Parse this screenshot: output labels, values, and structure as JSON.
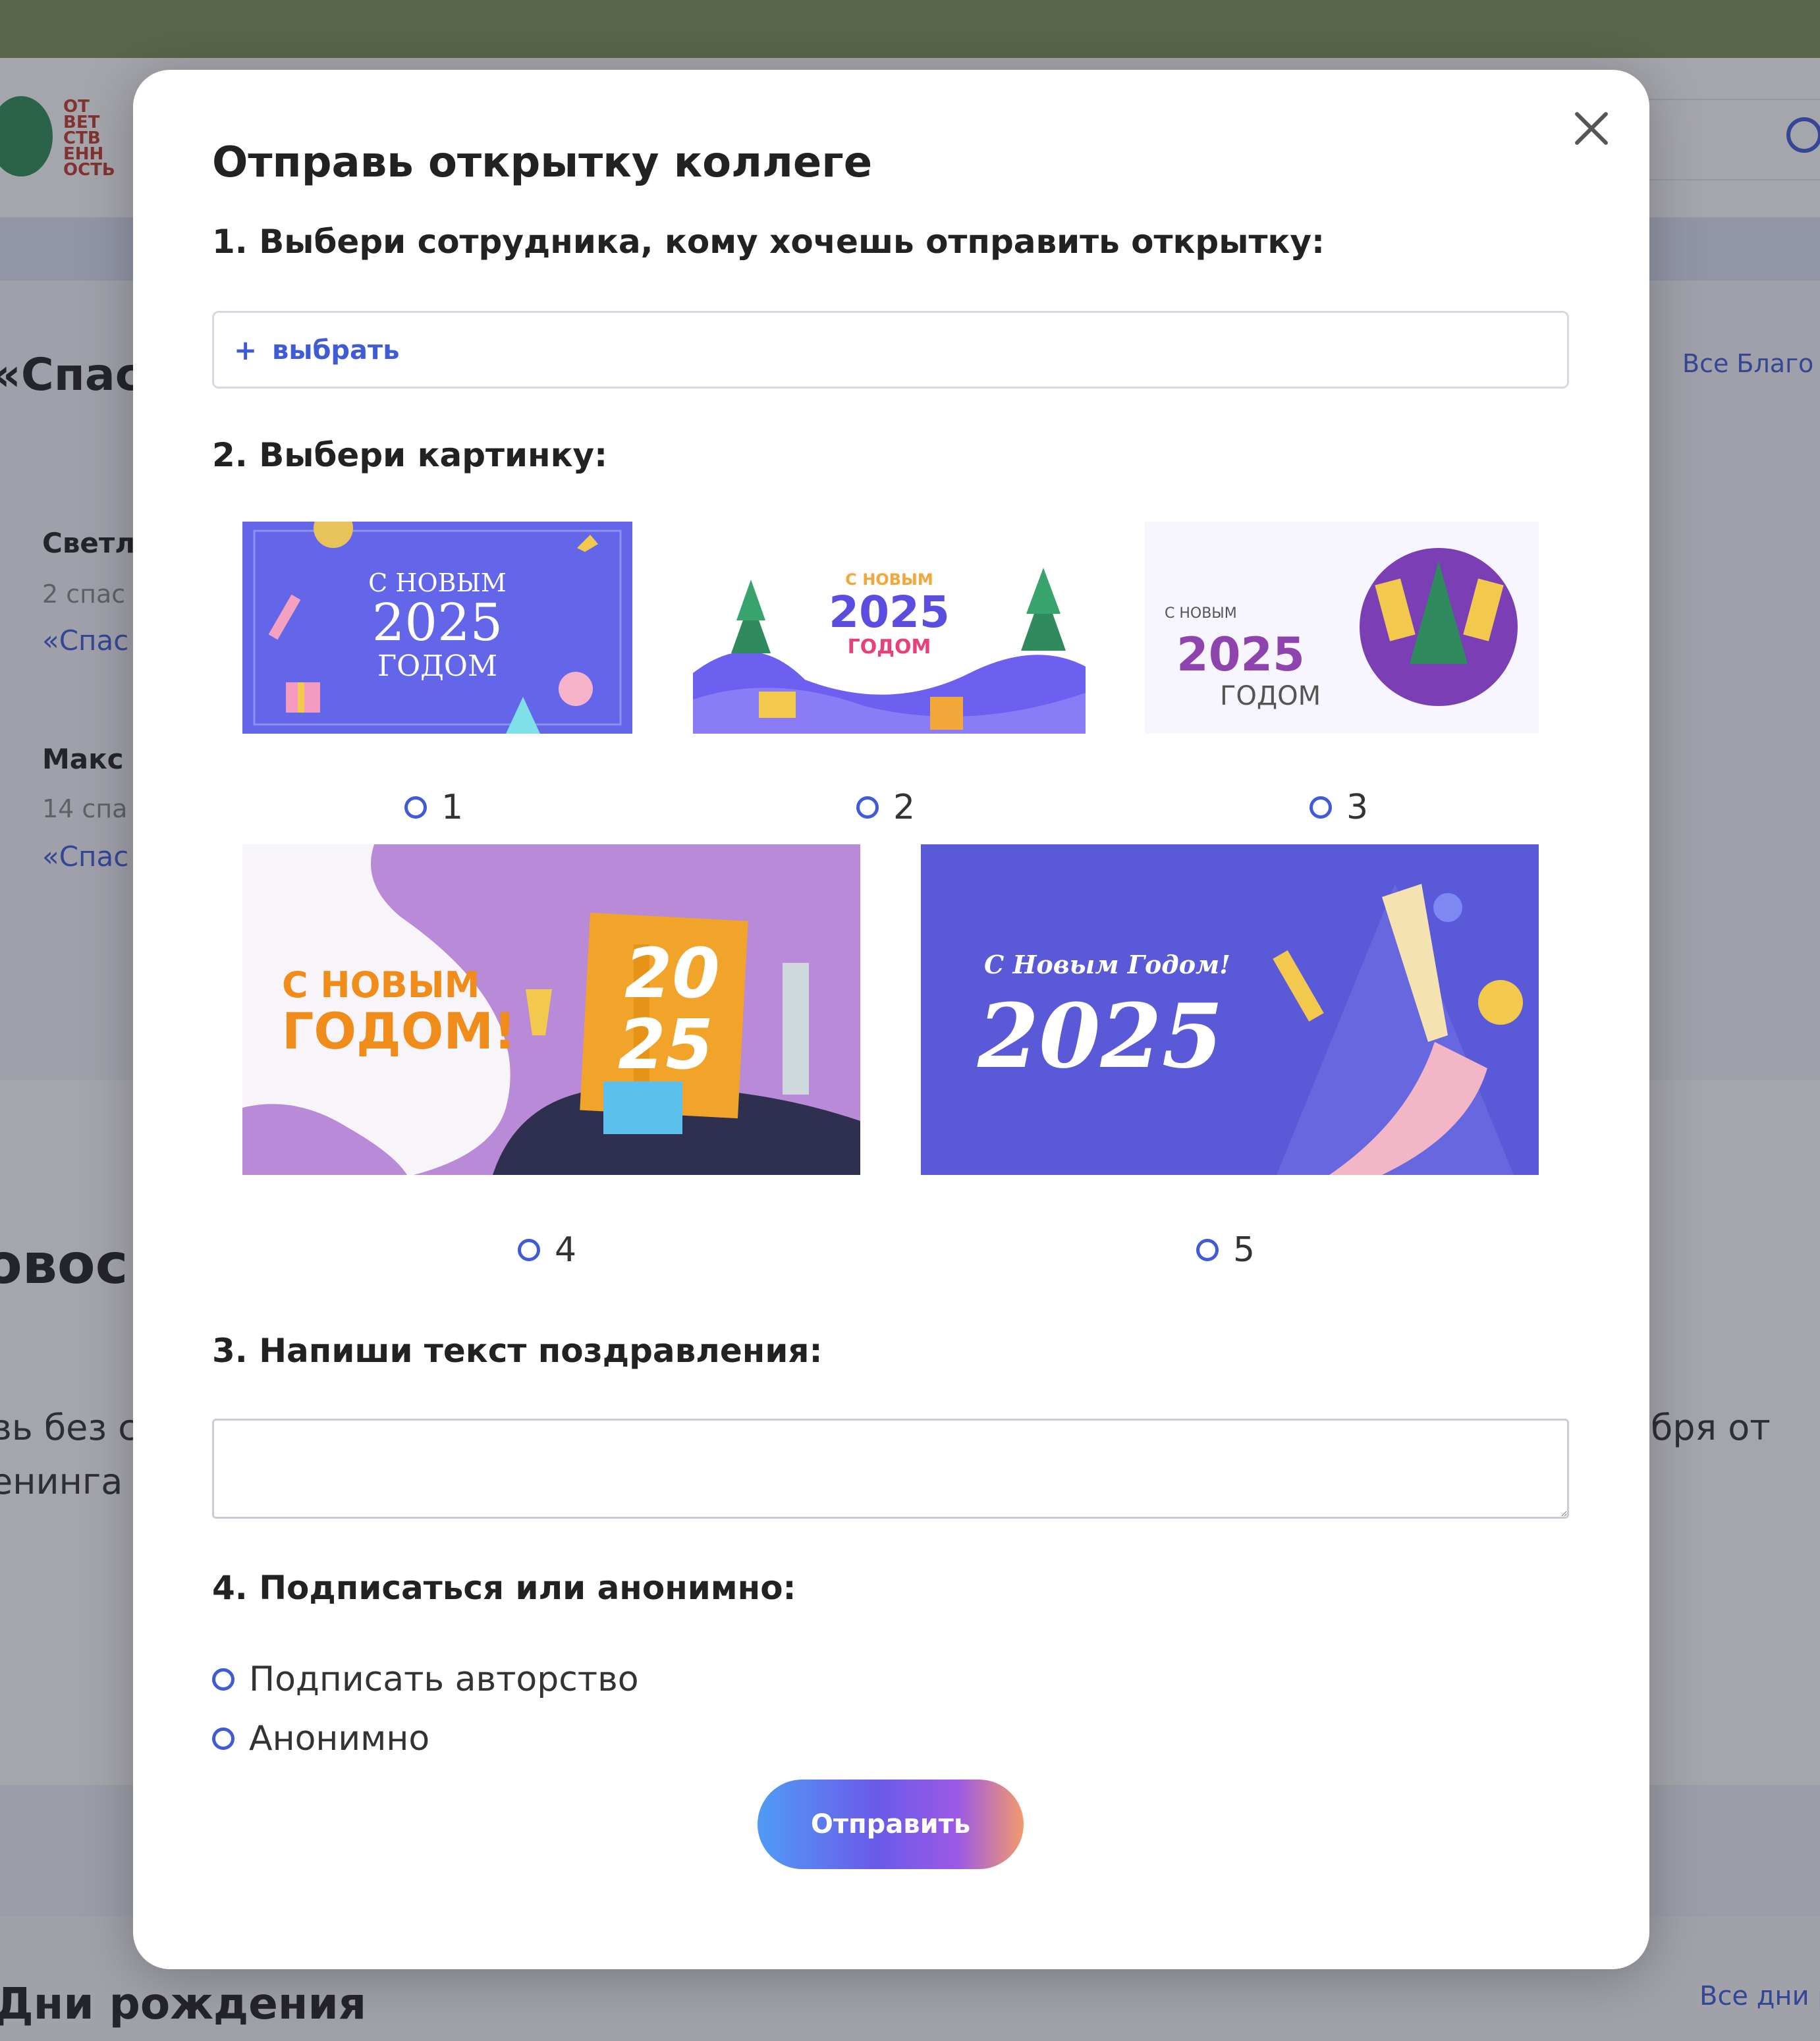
{
  "background": {
    "logo_text": "ОТ ВЕТ СТВ ЕНН ОСТЬ",
    "section1": {
      "heading": "«Спас",
      "all_link": "Все Благо",
      "entries": [
        {
          "name": "Светл",
          "count": "2 спас",
          "quote": "«Спас"
        },
        {
          "name": "Макс",
          "count": "14 спа",
          "quote": "«Спас"
        }
      ]
    },
    "section2": {
      "heading": "овос",
      "text_left_1": "вь без с",
      "text_left_2": "енинга",
      "text_right_1": "бря от"
    },
    "section3": {
      "heading": "Дни рождения",
      "all_link": "Все дни р"
    }
  },
  "modal": {
    "title": "Отправь открытку коллеге",
    "step1": {
      "label": "1. Выбери сотрудника, кому хочешь отправить открытку:",
      "select_icon": "+",
      "select_text": "выбрать"
    },
    "step2": {
      "label": "2. Выбери картинку:",
      "cards": [
        {
          "option": "1",
          "texts": [
            "С НОВЫМ",
            "2025",
            "ГОДОМ"
          ],
          "colors": {
            "bg": "#6366e8",
            "frame": "#8d90f0",
            "text": "#ffffff"
          }
        },
        {
          "option": "2",
          "texts": [
            "С НОВЫМ",
            "2025",
            "ГОДОМ"
          ],
          "colors": {
            "bg": "#ffffff",
            "accent": "#5b4de0",
            "hill": "#6d5ff0"
          }
        },
        {
          "option": "3",
          "texts": [
            "С НОВЫМ",
            "2025",
            "ГОДОМ"
          ],
          "colors": {
            "bg": "#f7f5fd",
            "accent": "#8e44ad",
            "circle": "#7b3fb5"
          }
        },
        {
          "option": "4",
          "texts": [
            "С НОВЫМ",
            "ГОДОМ!",
            "20",
            "25"
          ],
          "colors": {
            "bg": "#b88ad8",
            "text": "#f08c1a",
            "calendar": "#f2a42a"
          }
        },
        {
          "option": "5",
          "texts": [
            "С Новым Годом!",
            "2025"
          ],
          "colors": {
            "bg": "#5a5ad8",
            "text": "#ffffff",
            "hand": "#f2b6c6"
          }
        }
      ]
    },
    "step3": {
      "label": "3. Напиши текст поздравления:",
      "message_value": ""
    },
    "step4": {
      "label": "4. Подписаться или анонимно:",
      "options": [
        "Подписать авторство",
        "Анонимно"
      ]
    },
    "submit_label": "Отправить",
    "colors": {
      "accent": "#3f5bd6",
      "overlay": "rgba(40,42,58,0.42)"
    },
    "icons": {
      "close": "close-icon",
      "radio": "radio-icon",
      "plus": "plus-icon"
    }
  }
}
